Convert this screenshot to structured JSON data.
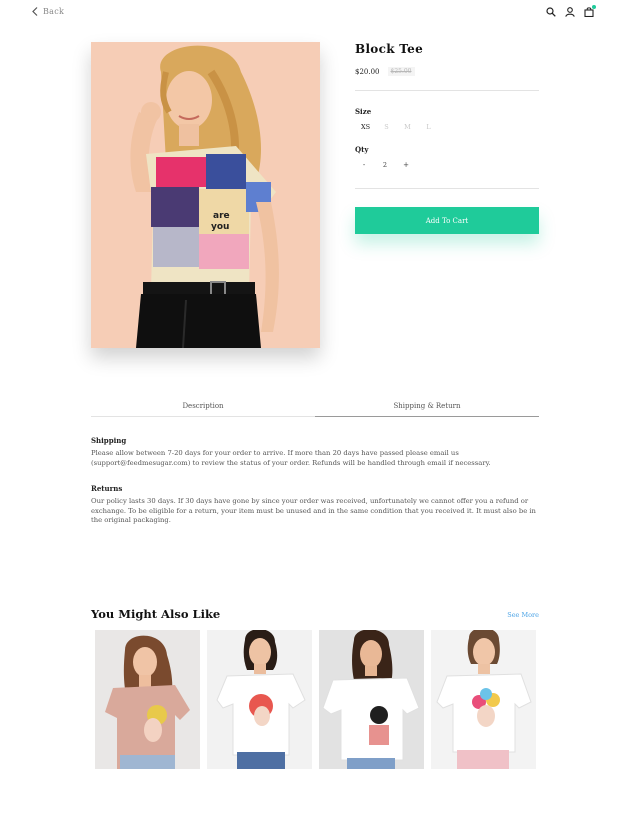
{
  "header": {
    "back_label": "Back",
    "icons": [
      "search-icon",
      "user-icon",
      "cart-icon"
    ],
    "cart_badge_color": "#1fcb9a"
  },
  "product": {
    "title": "Block Tee",
    "price": "$20.00",
    "old_price": "$25.00",
    "size_label": "Size",
    "sizes": [
      "XS",
      "S",
      "M",
      "L"
    ],
    "selected_size": "XS",
    "qty_label": "Qty",
    "qty_minus": "-",
    "qty_value": "2",
    "qty_plus": "+",
    "add_to_cart": "Add To Cart",
    "accent_color": "#1fcb9a"
  },
  "tabs": [
    {
      "label": "Description",
      "active": false
    },
    {
      "label": "Shipping & Return",
      "active": true
    }
  ],
  "shipping": {
    "heading": "Shipping",
    "text": "Please allow between 7-20 days for your order to arrive. If more than 20 days have passed please email us (support@feedmesugar.com) to review the status of your order. Refunds will be handled through email if necessary."
  },
  "returns": {
    "heading": "Returns",
    "text": "Our policy lasts 30 days. If 30 days have gone by since your order was received, unfortunately we cannot offer you a refund or exchange. To be eligible for a return, your item must be unused and in the same condition that you received it. It must also be in the original packaging."
  },
  "related": {
    "title": "You Might Also Like",
    "see_more": "See More"
  }
}
